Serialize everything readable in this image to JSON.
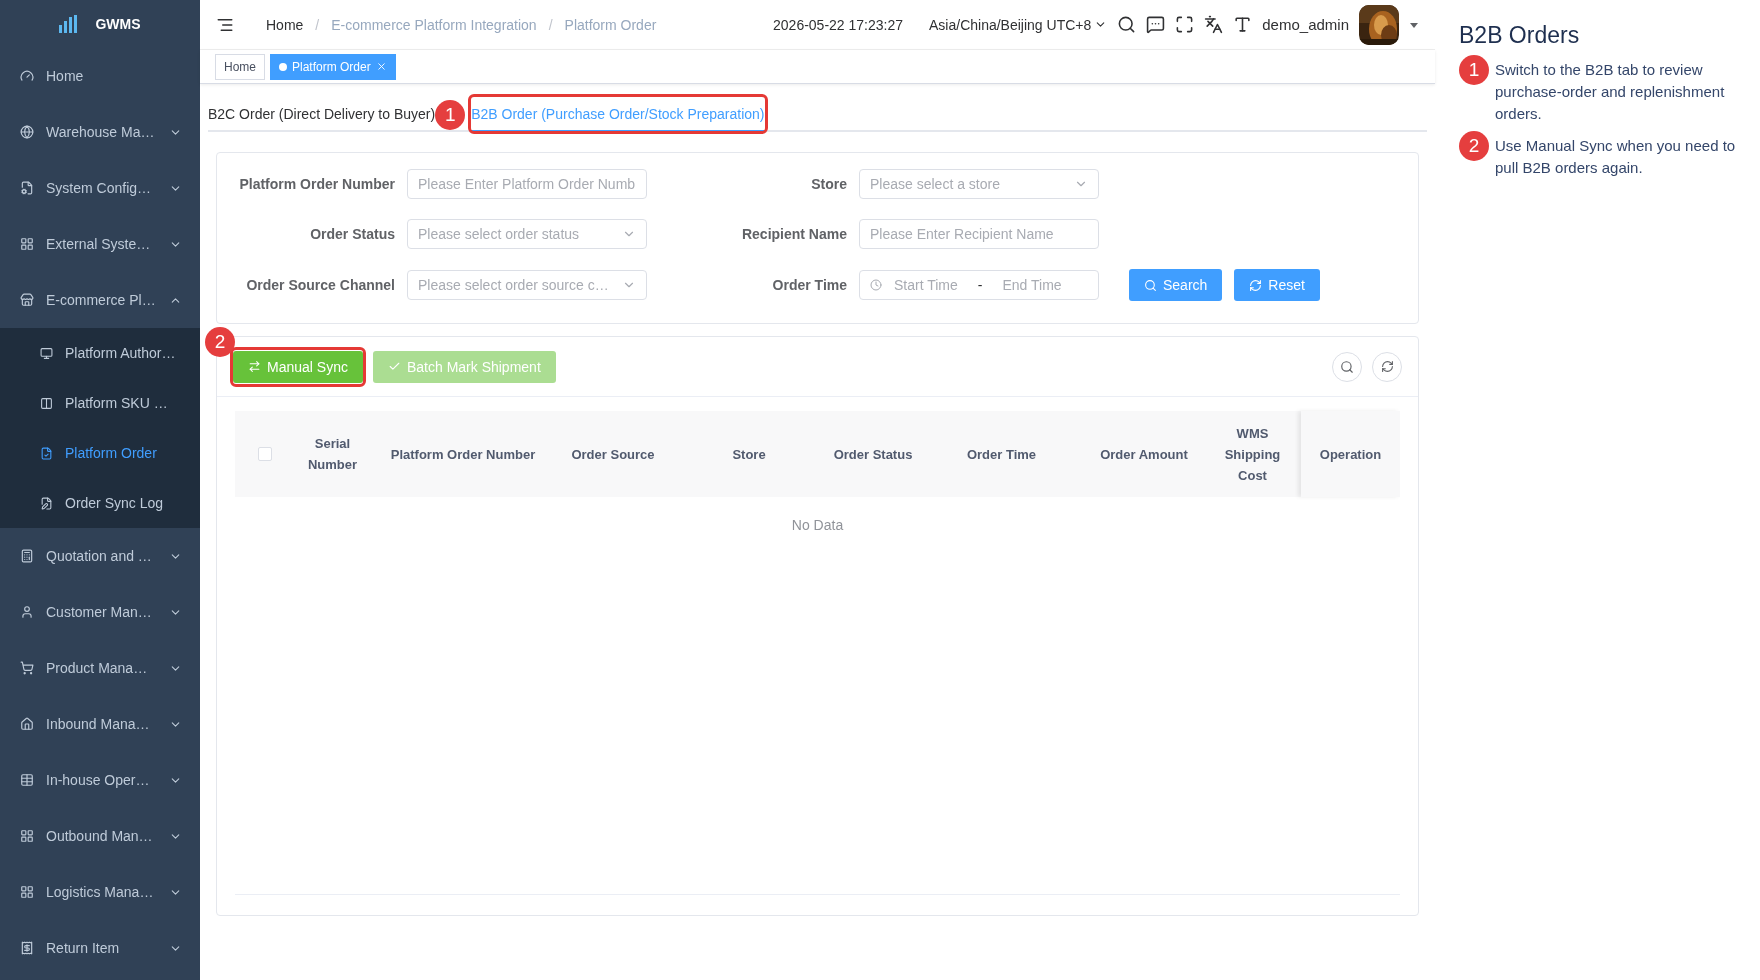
{
  "sidebar": {
    "logo": "GWMS",
    "items": [
      {
        "label": "Home",
        "kind": "link",
        "expanded": false
      },
      {
        "label": "Warehouse Ma…",
        "kind": "group",
        "expanded": false
      },
      {
        "label": "System Config…",
        "kind": "group",
        "expanded": false
      },
      {
        "label": "External Syste…",
        "kind": "group",
        "expanded": false
      },
      {
        "label": "E-commerce Pl…",
        "kind": "group",
        "expanded": true,
        "children": [
          {
            "label": "Platform Author…",
            "selected": false
          },
          {
            "label": "Platform SKU …",
            "selected": false
          },
          {
            "label": "Platform Order",
            "selected": true
          },
          {
            "label": "Order Sync Log",
            "selected": false
          }
        ]
      },
      {
        "label": "Quotation and …",
        "kind": "group",
        "expanded": false
      },
      {
        "label": "Customer Man…",
        "kind": "group",
        "expanded": false
      },
      {
        "label": "Product Mana…",
        "kind": "group",
        "expanded": false
      },
      {
        "label": "Inbound Mana…",
        "kind": "group",
        "expanded": false
      },
      {
        "label": "In-house Oper…",
        "kind": "group",
        "expanded": false
      },
      {
        "label": "Outbound Man…",
        "kind": "group",
        "expanded": false
      },
      {
        "label": "Logistics Mana…",
        "kind": "group",
        "expanded": false
      },
      {
        "label": "Return Item",
        "kind": "group",
        "expanded": false
      }
    ]
  },
  "header": {
    "breadcrumb_separator": "/",
    "breadcrumb": [
      "Home",
      "E-commerce Platform Integration",
      "Platform Order"
    ],
    "datetime": "2026-05-22 17:23:27",
    "timezone": "Asia/China/Beijing UTC+8",
    "user": "demo_admin",
    "avatar": {
      "kind": "picture"
    }
  },
  "tags": [
    {
      "label": "Home",
      "selected": false
    },
    {
      "label": "Platform Order",
      "selected": true
    }
  ],
  "tabs": [
    {
      "label": "B2C Order (Direct Delivery to Buyer)",
      "selected": false
    },
    {
      "label": "B2B Order (Purchase Order/Stock Preparation)",
      "selected": true
    }
  ],
  "filters": [
    {
      "label": "Platform Order Number",
      "kind": "input",
      "placeholder": "Please Enter Platform Order Numb"
    },
    {
      "label": "Store",
      "kind": "select",
      "placeholder": "Please select a store"
    },
    {
      "label": "Order Status",
      "kind": "select",
      "placeholder": "Please select order status"
    },
    {
      "label": "Recipient Name",
      "kind": "input",
      "placeholder": "Please Enter Recipient Name"
    },
    {
      "label": "Order Source Channel",
      "kind": "select",
      "placeholder": "Please select order source c…"
    },
    {
      "label": "Order Time",
      "kind": "daterange",
      "start_placeholder": "Start Time",
      "separator": "-",
      "end_placeholder": "End Time"
    }
  ],
  "filter_buttons": [
    {
      "label": "Search",
      "kind": "search"
    },
    {
      "label": "Reset",
      "kind": "reset"
    }
  ],
  "toolbar": [
    {
      "label": "Manual Sync",
      "kind": "sync",
      "disabled": false
    },
    {
      "label": "Batch Mark Shipment",
      "kind": "check",
      "disabled": true
    }
  ],
  "table": {
    "select_all_checked": false,
    "columns": [
      "Serial Number",
      "Platform Order Number",
      "Order Source",
      "Store",
      "Order Status",
      "Order Time",
      "Order Amount",
      "WMS Shipping Cost",
      "Operation"
    ],
    "empty_text": "No Data"
  },
  "callouts": [
    {
      "number": "1"
    },
    {
      "number": "2"
    }
  ],
  "help_panel": {
    "title": "B2B Orders",
    "steps": [
      {
        "number": "1",
        "text": "Switch to the B2B tab to review purchase-order and replenishment orders."
      },
      {
        "number": "2",
        "text": "Use Manual Sync when you need to pull B2B orders again."
      }
    ]
  }
}
